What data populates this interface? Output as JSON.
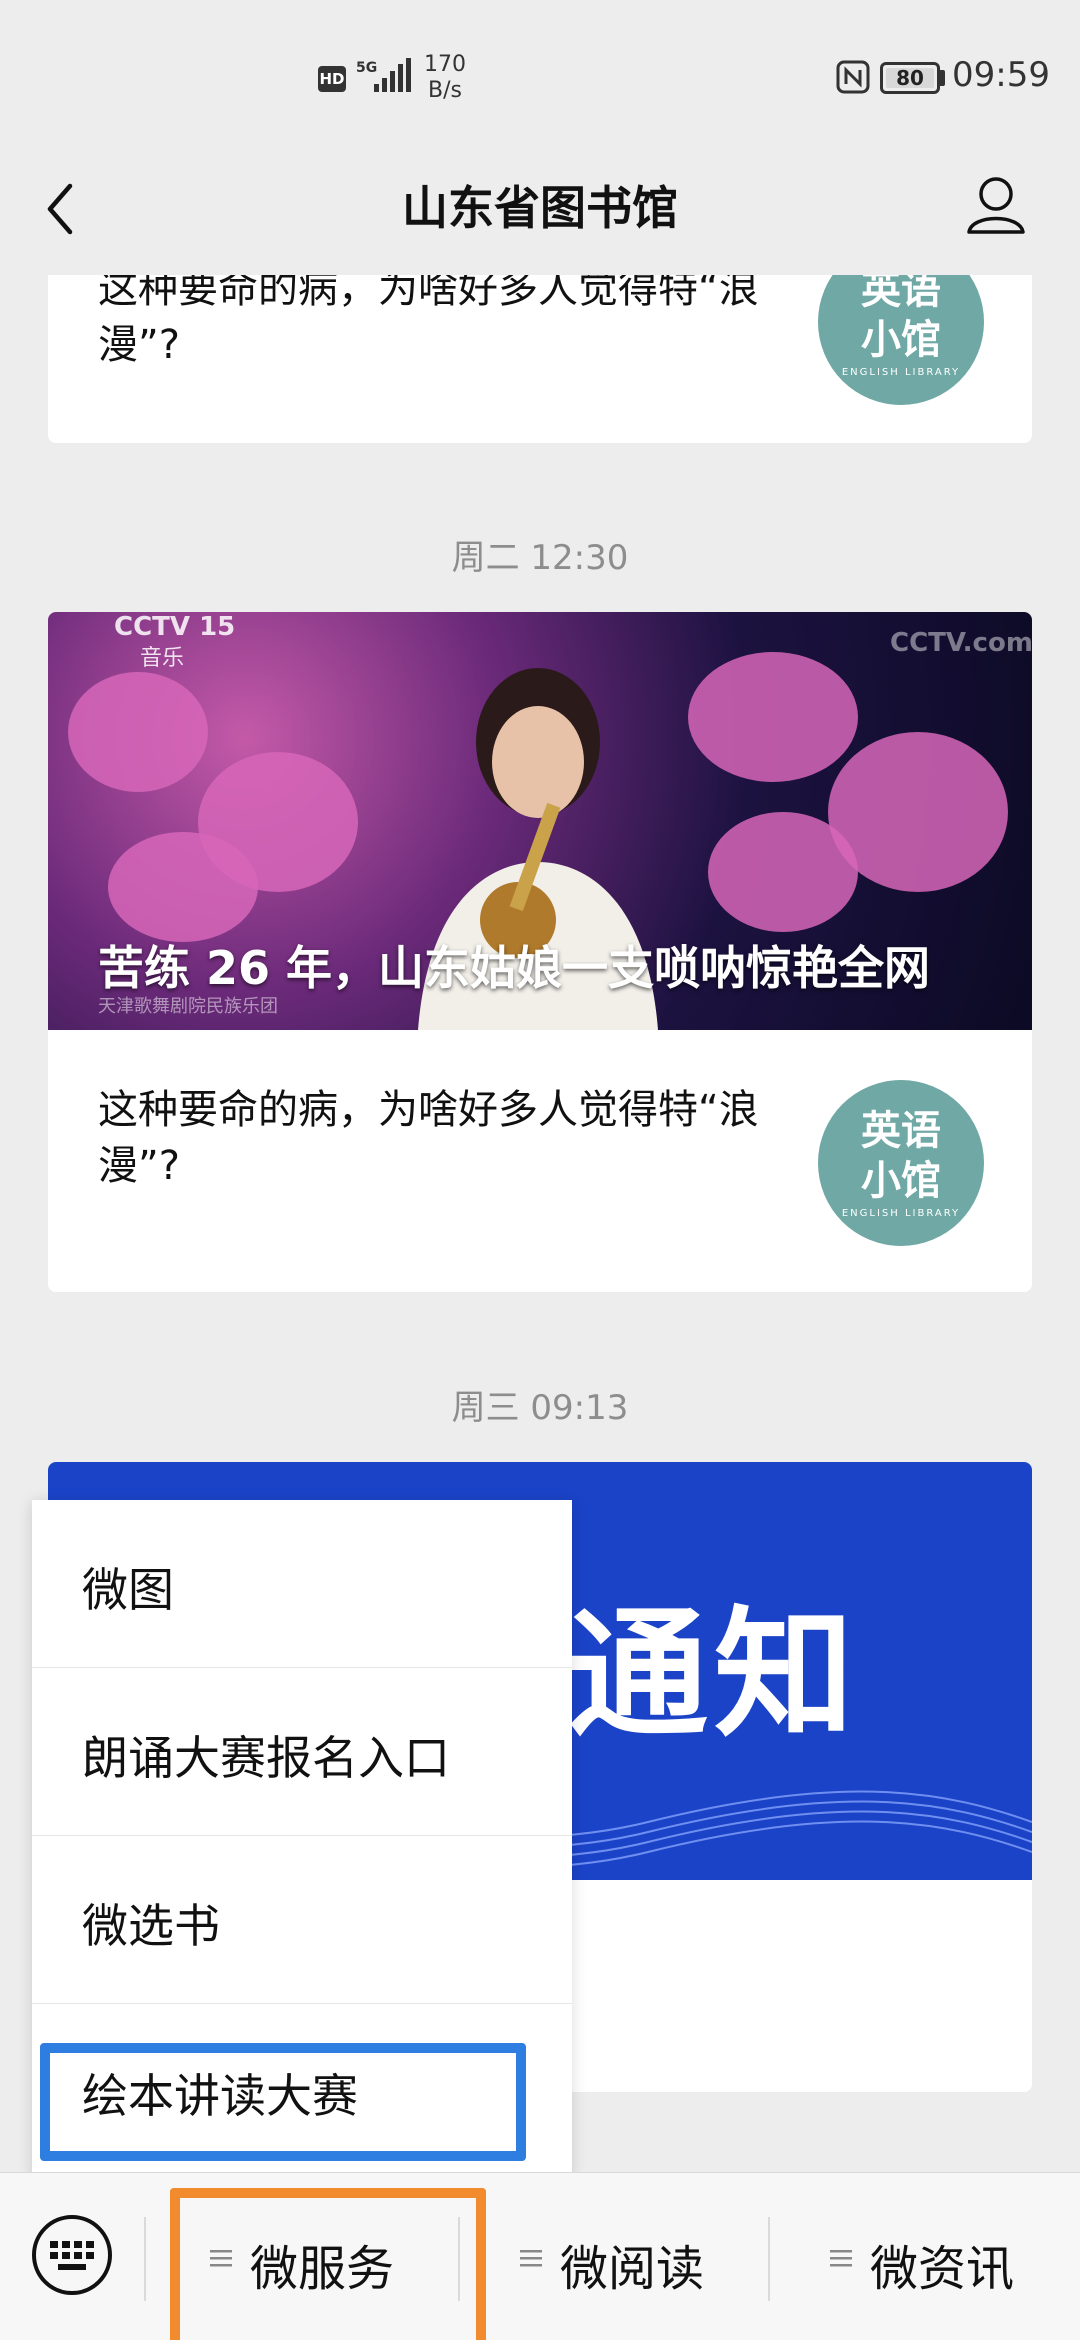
{
  "status_bar": {
    "hd": "HD",
    "network": "5G",
    "speed_value": "170",
    "speed_unit": "B/s",
    "battery": "80",
    "time": "09:59"
  },
  "header": {
    "title": "山东省图书馆",
    "back_icon": "back-chevron-icon",
    "profile_icon": "user-profile-icon"
  },
  "feed": {
    "top_card": {
      "text": "这种要命的病，为啥好多人觉得特“浪漫”?",
      "thumb_line1": "英语",
      "thumb_line2": "小馆",
      "thumb_line3": "ENGLISH LIBRARY"
    },
    "group2": {
      "timestamp": "周二 12:30",
      "video_logo": "CCTV 15",
      "video_sub": "音乐",
      "video_logo_right": "CCTV.com",
      "video_caption": "苦练 26 年，山东姑娘一支唢呐惊艳全网",
      "video_credit": "天津歌舞剧院民族乐团",
      "article_text": "这种要命的病，为啥好多人觉得特“浪漫”?",
      "thumb_line1": "英语",
      "thumb_line2": "小馆",
      "thumb_line3": "ENGLISH LIBRARY"
    },
    "group3": {
      "timestamp": "周三 09:13",
      "banner_text": "通知"
    }
  },
  "popup_menu": {
    "items": [
      {
        "label": "微图"
      },
      {
        "label": "朗诵大赛报名入口"
      },
      {
        "label": "微选书"
      },
      {
        "label": "绘本讲读大赛",
        "highlighted": true
      }
    ],
    "highlight_color": "#2d7ee0"
  },
  "bottom_bar": {
    "keyboard_icon": "keyboard-icon",
    "tabs": [
      {
        "label": "微服务",
        "highlighted": true
      },
      {
        "label": "微阅读"
      },
      {
        "label": "微资讯"
      }
    ],
    "highlight_color": "#f28a2e"
  }
}
